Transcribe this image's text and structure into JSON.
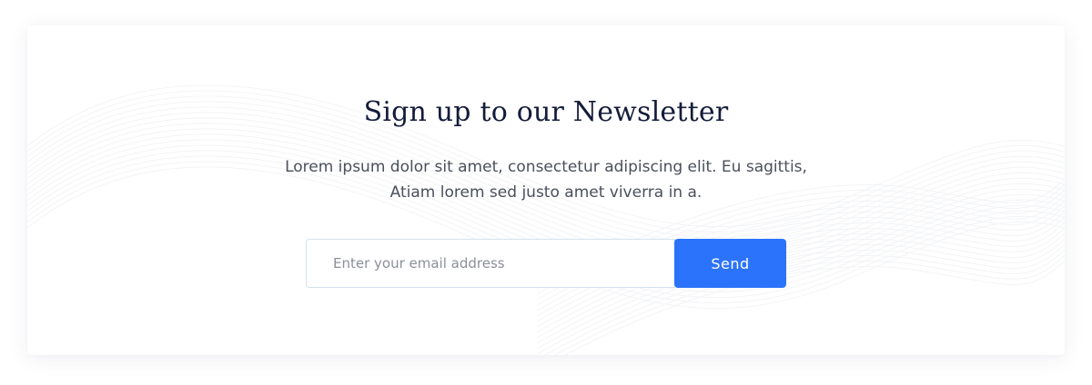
{
  "newsletter": {
    "title": "Sign up to our Newsletter",
    "description_line1": "Lorem ipsum dolor sit amet, consectetur adipiscing elit. Eu sagittis,",
    "description_line2": "Atiam lorem sed justo amet viverra in a.",
    "email_placeholder": "Enter your email address",
    "email_value": "",
    "send_label": "Send"
  },
  "colors": {
    "accent": "#2c73fb",
    "title": "#141c3b",
    "body_text": "#4b4f5c",
    "input_border": "#d3e2ef"
  }
}
